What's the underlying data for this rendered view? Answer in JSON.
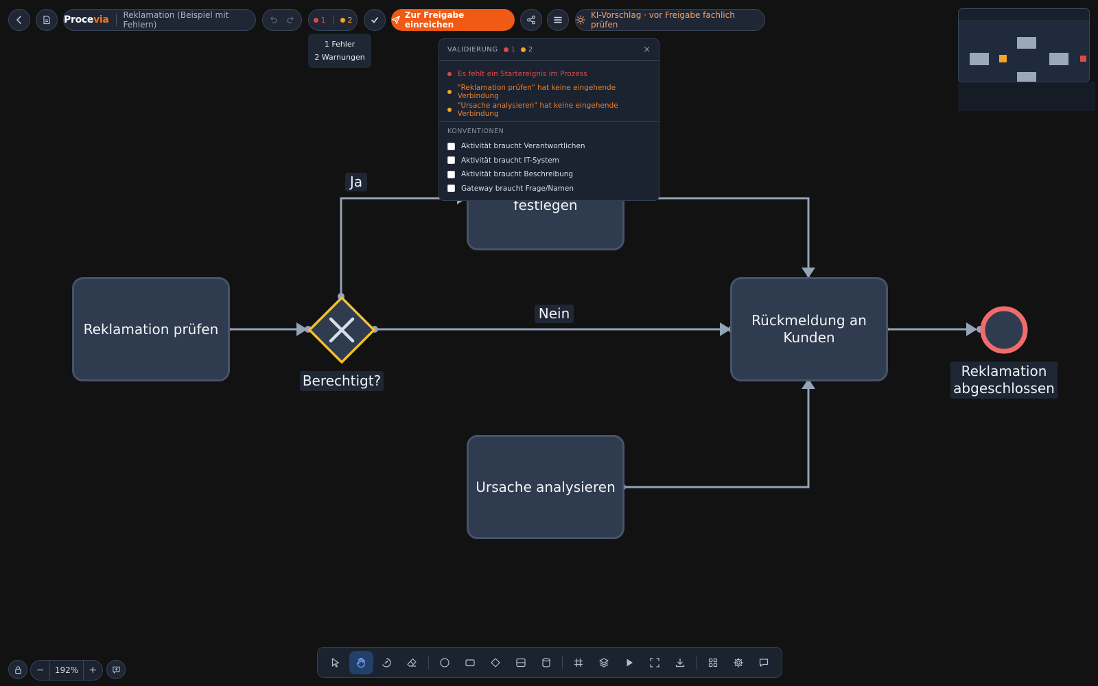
{
  "header": {
    "brand_left": "Proce",
    "brand_right": "via",
    "doc_title": "Reklamation (Beispiel mit Fehlern)",
    "error_count": "1",
    "warning_count": "2",
    "submit_label": "Zur Freigabe einreichen",
    "ai_suggestion": "KI-Vorschlag · vor Freigabe fachlich prüfen"
  },
  "tooltip": {
    "line1": "1 Fehler",
    "line2": "2 Warnungen"
  },
  "validation": {
    "title": "VALIDIERUNG",
    "error_count": "1",
    "warning_count": "2",
    "close": "×",
    "issues": [
      {
        "type": "error",
        "text": "Es fehlt ein Startereignis im Prozess"
      },
      {
        "type": "warning",
        "text": "\"Reklamation prüfen\" hat keine eingehende Verbindung"
      },
      {
        "type": "warning",
        "text": "\"Ursache analysieren\" hat keine eingehende Verbindung"
      }
    ],
    "conventions_title": "KONVENTIONEN",
    "conventions": [
      "Aktivität braucht Verantwortlichen",
      "Aktivität braucht IT-System",
      "Aktivität braucht Beschreibung",
      "Gateway braucht Frage/Namen"
    ]
  },
  "diagram": {
    "task_check": "Reklamation prüfen",
    "task_define": "festlegen",
    "task_feedback": "Rückmeldung an Kunden",
    "task_analyze": "Ursache analysieren",
    "gateway_label": "Berechtigt?",
    "edge_yes": "Ja",
    "edge_no": "Nein",
    "end_event": "Reklamation abgeschlossen"
  },
  "zoom": {
    "minus": "−",
    "value": "192%",
    "plus": "+"
  },
  "colors": {
    "accent": "#f05a14",
    "error": "#e04848",
    "warning": "#f5a524",
    "gateway": "#f5c02a",
    "end_event": "#f26b6b"
  }
}
